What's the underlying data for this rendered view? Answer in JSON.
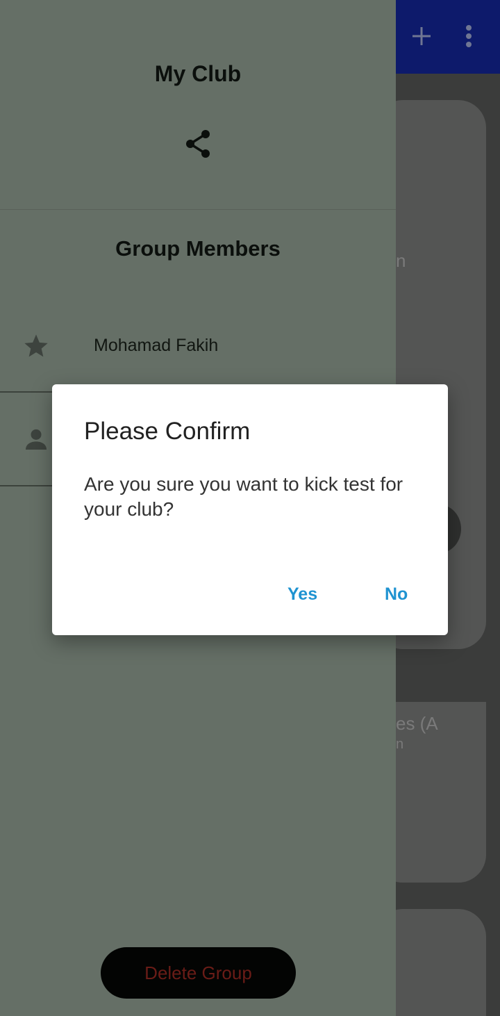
{
  "app_bar": {
    "add_icon": "plus-icon",
    "menu_icon": "more-vert-icon",
    "color": "#0d1a6b"
  },
  "background": {
    "fragment_1": "n",
    "fragment_2": "es (A",
    "fragment_3": "n"
  },
  "drawer": {
    "title": "My Club",
    "share_icon": "share-icon",
    "members_heading": "Group Members",
    "members": [
      {
        "name": "Mohamad Fakih",
        "icon": "star-icon"
      },
      {
        "name": "",
        "icon": "person-icon"
      }
    ],
    "delete_button_label": "Delete Group"
  },
  "dialog": {
    "title": "Please Confirm",
    "message": "Are you sure you want to kick test for your club?",
    "yes_label": "Yes",
    "no_label": "No",
    "accent_color": "#1f93d1"
  }
}
